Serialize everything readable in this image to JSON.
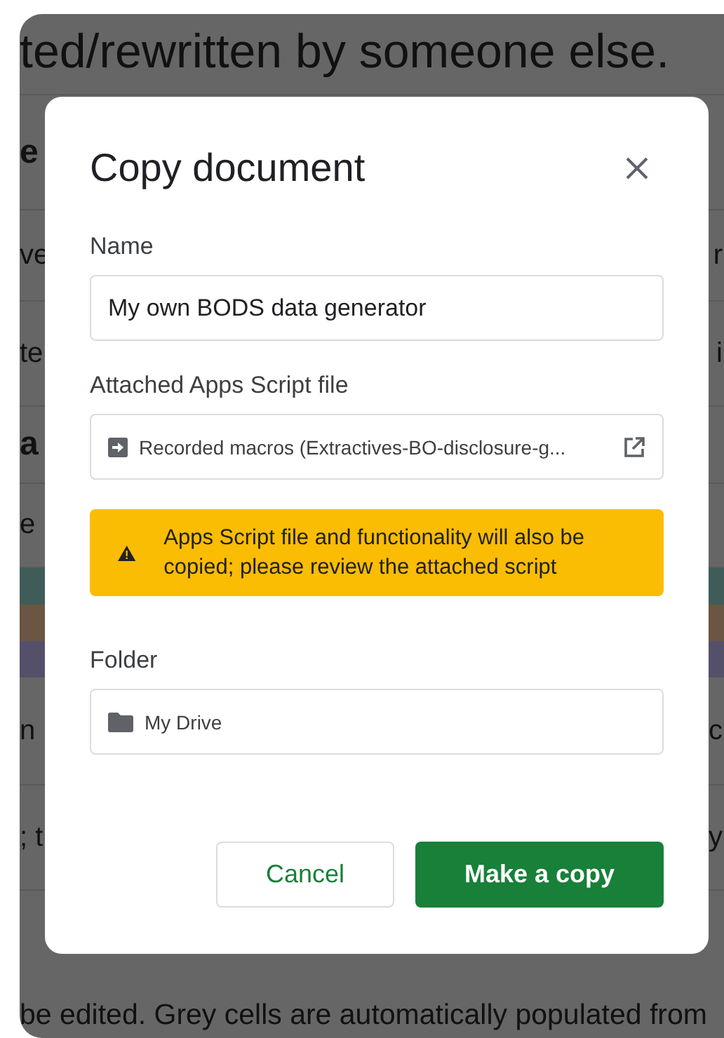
{
  "background": {
    "heading": "ted/rewritten by someone else.",
    "rows": [
      {
        "kind": "bold",
        "left": "e"
      },
      {
        "kind": "text",
        "left": "ve",
        "right": "r"
      },
      {
        "kind": "text",
        "left": "te",
        "right": "i"
      },
      {
        "kind": "bold",
        "left": "a"
      },
      {
        "kind": "text",
        "left": "e"
      },
      {
        "kind": "swatch",
        "color": "#3f5c59"
      },
      {
        "kind": "swatch",
        "color": "#6a5643"
      },
      {
        "kind": "swatch",
        "color": "#55506a"
      },
      {
        "kind": "text",
        "left": "n",
        "right": "c"
      },
      {
        "kind": "text",
        "left": "; t",
        "right": "y"
      }
    ],
    "footer": "be edited. Grey cells are automatically populated from"
  },
  "dialog": {
    "title": "Copy document",
    "name_field": {
      "label": "Name",
      "value": "My own BODS data generator"
    },
    "script_file": {
      "label": "Attached Apps Script file",
      "file": "Recorded macros (Extractives-BO-disclosure-g..."
    },
    "warning": "Apps Script file and functionality will also be copied; please review the attached script",
    "folder": {
      "label": "Folder",
      "value": "My Drive"
    },
    "buttons": [
      {
        "label": "Cancel",
        "kind": "secondary"
      },
      {
        "label": "Make a copy",
        "kind": "primary"
      }
    ]
  }
}
